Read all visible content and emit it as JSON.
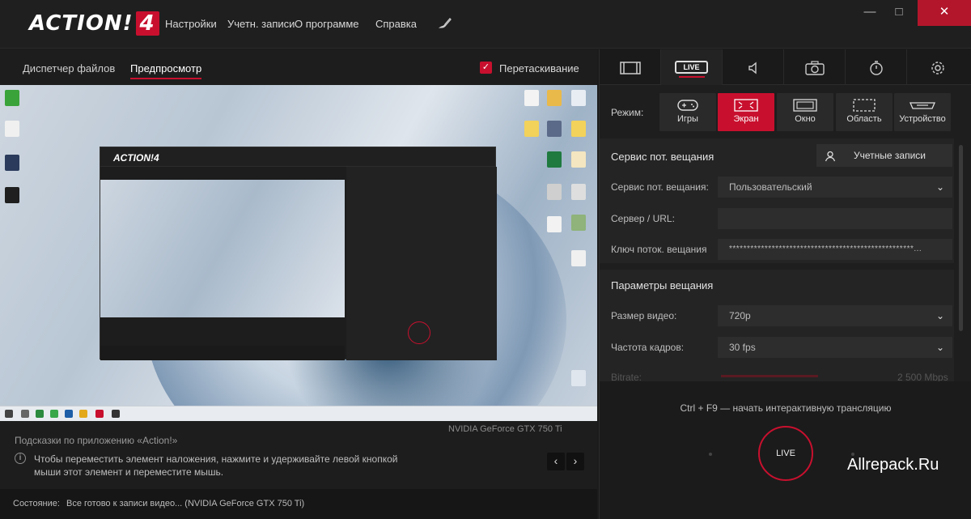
{
  "app": {
    "logo_text": "ACTION!",
    "logo_version": "4"
  },
  "menu": {
    "settings": "Настройки",
    "accounts": "Учетн. записи",
    "about": "О программе",
    "help": "Справка"
  },
  "window_controls": {
    "minimize": "—",
    "maximize": "□",
    "close": "✕"
  },
  "left": {
    "tabs": {
      "file_manager": "Диспетчер файлов",
      "preview": "Предпросмотр"
    },
    "drag_checkbox": {
      "checked": true,
      "label": "Перетаскивание"
    },
    "gpu_label": "NVIDIA GeForce GTX 750 Ti",
    "hints": {
      "title": "Подсказки по приложению «Action!»",
      "text": "Чтобы переместить элемент наложения, нажмите и удерживайте левой кнопкой мыши этот элемент и переместите мышь.",
      "prev": "‹",
      "next": "›"
    }
  },
  "statusbar": {
    "label": "Состояние:",
    "text": "Все готово к записи видео...  (NVIDIA GeForce GTX 750 Ti)"
  },
  "right": {
    "tabs": [
      {
        "name": "video",
        "icon": "film-icon"
      },
      {
        "name": "live",
        "label": "LIVE"
      },
      {
        "name": "audio",
        "icon": "speaker-icon"
      },
      {
        "name": "screenshot",
        "icon": "camera-icon"
      },
      {
        "name": "timer",
        "icon": "timer-icon"
      },
      {
        "name": "settings",
        "icon": "gear-icon"
      }
    ],
    "mode": {
      "label": "Режим:",
      "options": [
        {
          "label": "Игры",
          "icon": "gamepad-icon",
          "active": false
        },
        {
          "label": "Экран",
          "icon": "screen-icon",
          "active": true
        },
        {
          "label": "Окно",
          "icon": "window-icon",
          "active": false
        },
        {
          "label": "Область",
          "icon": "area-icon",
          "active": false
        },
        {
          "label": "Устройство",
          "icon": "device-icon",
          "active": false
        }
      ]
    },
    "streaming": {
      "heading": "Сервис пот. вещания",
      "accounts_button": "Учетные записи",
      "service_label": "Сервис пот. вещания:",
      "service_value": "Пользовательский",
      "server_label": "Сервер / URL:",
      "server_value": "",
      "key_label": "Ключ поток. вещания",
      "key_value": "****************************************************..."
    },
    "broadcast": {
      "heading": "Параметры вещания",
      "video_size_label": "Размер видео:",
      "video_size_value": "720p",
      "fps_label": "Частота кадров:",
      "fps_value": "30 fps",
      "bitrate_label": "Bitrate:",
      "bitrate_value": "2 500 Mbps"
    },
    "hotkey_text": "Ctrl + F9 — начать интерактивную трансляцию",
    "live_button": "LIVE",
    "watermark": "Allrepack.Ru"
  },
  "colors": {
    "accent": "#c8102e",
    "bg": "#1b1b1b",
    "panel": "#242424",
    "field": "#2d2d2d"
  }
}
